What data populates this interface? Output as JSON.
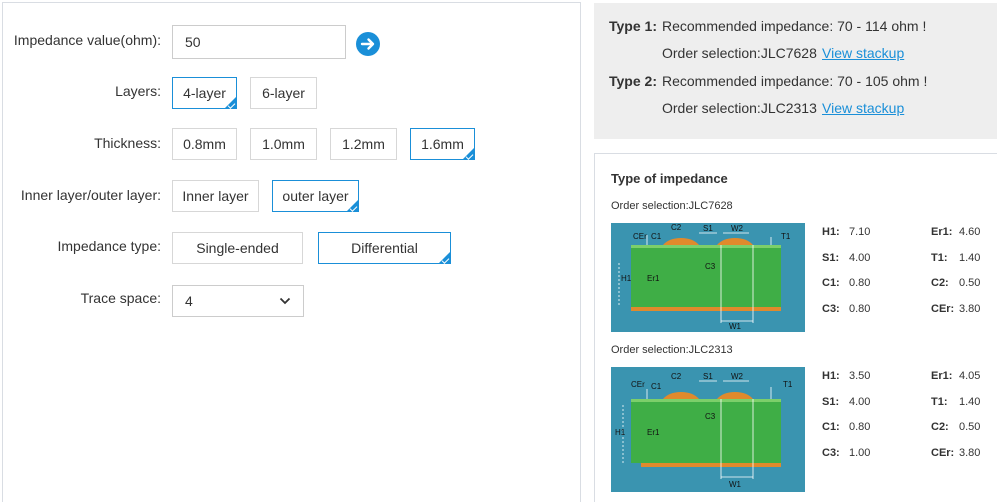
{
  "form": {
    "impedance_label": "Impedance value(ohm):",
    "impedance_value": "50",
    "go_icon": "arrow-right-icon",
    "layers_label": "Layers:",
    "layers_options": [
      "4-layer",
      "6-layer"
    ],
    "layers_selected": "4-layer",
    "thickness_label": "Thickness:",
    "thickness_options": [
      "0.8mm",
      "1.0mm",
      "1.2mm",
      "1.6mm"
    ],
    "thickness_selected": "1.6mm",
    "inner_outer_label": "Inner layer/outer layer:",
    "inner_outer_options": [
      "Inner layer",
      "outer layer"
    ],
    "inner_outer_selected": "outer layer",
    "imp_type_label": "Impedance type:",
    "imp_type_options": [
      "Single-ended",
      "Differential"
    ],
    "imp_type_selected": "Differential",
    "trace_space_label": "Trace space:",
    "trace_space_value": "4"
  },
  "results": [
    {
      "type_label": "Type 1:",
      "recommended": "Recommended impedance: 70 - 114 ohm !",
      "order_selection": "Order selection:JLC7628",
      "link": "View stackup"
    },
    {
      "type_label": "Type 2:",
      "recommended": "Recommended impedance: 70 - 105 ohm !",
      "order_selection": "Order selection:JLC2313",
      "link": "View stackup"
    }
  ],
  "impedance_panel": {
    "title": "Type of impedance",
    "diagram_labels": {
      "ce": "CEr",
      "c1": "C1",
      "c2": "C2",
      "s1": "S1",
      "w2": "W2",
      "t1": "T1",
      "c3": "C3",
      "h1": "H1",
      "er1": "Er1",
      "w1": "W1"
    },
    "stackups": [
      {
        "order_selection": "Order selection:JLC7628",
        "params": [
          {
            "k": "H1:",
            "v": "7.10"
          },
          {
            "k": "Er1:",
            "v": "4.60"
          },
          {
            "k": "S1:",
            "v": "4.00"
          },
          {
            "k": "T1:",
            "v": "1.40"
          },
          {
            "k": "C1:",
            "v": "0.80"
          },
          {
            "k": "C2:",
            "v": "0.50"
          },
          {
            "k": "C3:",
            "v": "0.80"
          },
          {
            "k": "CEr:",
            "v": "3.80"
          }
        ]
      },
      {
        "order_selection": "Order selection:JLC2313",
        "params": [
          {
            "k": "H1:",
            "v": "3.50"
          },
          {
            "k": "Er1:",
            "v": "4.05"
          },
          {
            "k": "S1:",
            "v": "4.00"
          },
          {
            "k": "T1:",
            "v": "1.40"
          },
          {
            "k": "C1:",
            "v": "0.80"
          },
          {
            "k": "C2:",
            "v": "0.50"
          },
          {
            "k": "C3:",
            "v": "1.00"
          },
          {
            "k": "CEr:",
            "v": "3.80"
          }
        ]
      }
    ]
  },
  "colors": {
    "accent": "#1a8fd8",
    "panel_bg": "#eeeeee",
    "diagram_bg": "#3a94b0",
    "pcb_green": "#3fae46",
    "copper": "#e08a2c"
  }
}
